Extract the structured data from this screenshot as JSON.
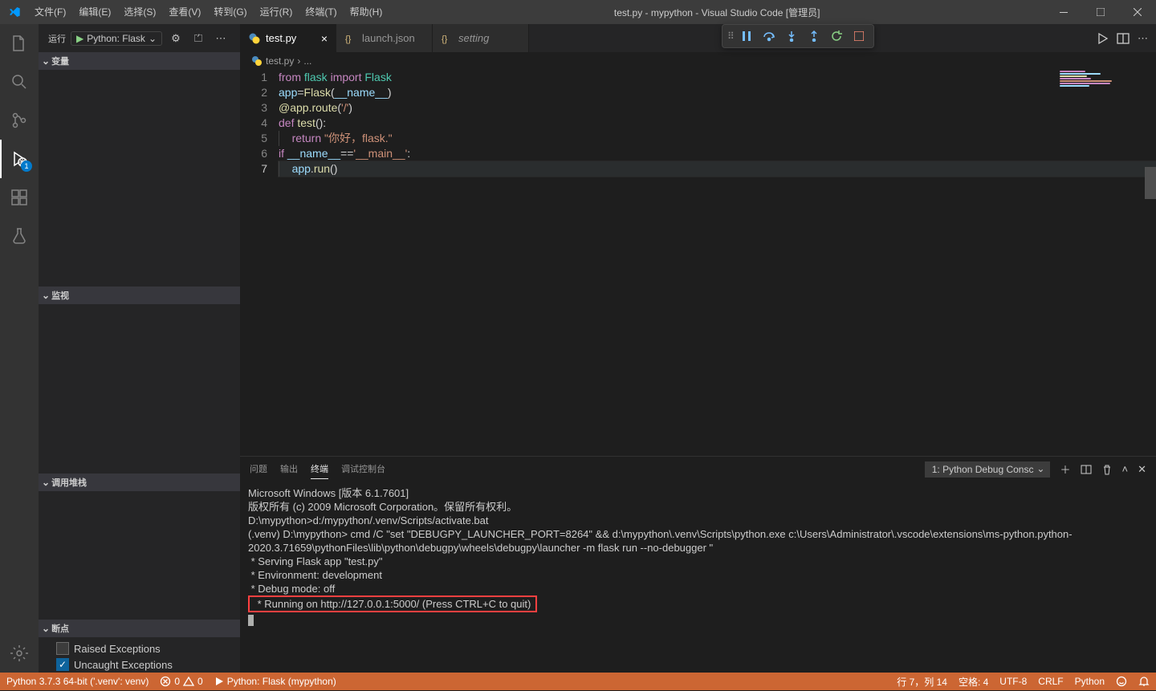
{
  "titlebar": {
    "menus": [
      "文件(F)",
      "编辑(E)",
      "选择(S)",
      "查看(V)",
      "转到(G)",
      "运行(R)",
      "终端(T)",
      "帮助(H)"
    ],
    "title": "test.py - mypython - Visual Studio Code [管理员]"
  },
  "activitybar": {
    "debug_badge": "1"
  },
  "sidebar": {
    "run_label": "运行",
    "config": "Python: Flask",
    "sections": {
      "variables": "变量",
      "watch": "监视",
      "callstack": "调用堆栈",
      "breakpoints": "断点"
    },
    "breakpoints": [
      {
        "label": "Raised Exceptions",
        "checked": false
      },
      {
        "label": "Uncaught Exceptions",
        "checked": true
      }
    ]
  },
  "tabs": [
    {
      "label": "test.py",
      "icon": "python",
      "active": true,
      "dirty": false
    },
    {
      "label": "launch.json",
      "icon": "json",
      "active": false,
      "dirty": false
    },
    {
      "label": "setting",
      "icon": "json",
      "active": false,
      "dirty": true,
      "italic": true
    }
  ],
  "breadcrumbs": [
    "test.py",
    "..."
  ],
  "code": {
    "lines": 7,
    "current_line": 7
  },
  "code_tokens": [
    [
      [
        "from",
        "kw"
      ],
      [
        " ",
        "p"
      ],
      [
        "flask",
        "mod"
      ],
      [
        " ",
        "p"
      ],
      [
        "import",
        "kw"
      ],
      [
        " ",
        "p"
      ],
      [
        "Flask",
        "mod"
      ]
    ],
    [
      [
        "app",
        "var"
      ],
      [
        "=",
        "op"
      ],
      [
        "Flask",
        "fn"
      ],
      [
        "(",
        "p"
      ],
      [
        "__name__",
        "var"
      ],
      [
        ")",
        "p"
      ]
    ],
    [
      [
        "@app.route",
        "at"
      ],
      [
        "(",
        "p"
      ],
      [
        "'/'",
        "str"
      ],
      [
        ")",
        "p"
      ]
    ],
    [
      [
        "def",
        "kw"
      ],
      [
        " ",
        "p"
      ],
      [
        "test",
        "fn"
      ],
      [
        "():",
        "p"
      ]
    ],
    [
      [
        "    ",
        "p"
      ],
      [
        "return",
        "kw"
      ],
      [
        " ",
        "p"
      ],
      [
        "\"你好，flask.\"",
        "str"
      ]
    ],
    [
      [
        "if",
        "kw"
      ],
      [
        " ",
        "p"
      ],
      [
        "__name__",
        "var"
      ],
      [
        "==",
        "op"
      ],
      [
        "'__main__'",
        "str"
      ],
      [
        ":",
        "p"
      ]
    ],
    [
      [
        "    ",
        "p"
      ],
      [
        "app",
        "var"
      ],
      [
        ".",
        "p"
      ],
      [
        "run",
        "fn"
      ],
      [
        "()",
        "p"
      ]
    ]
  ],
  "panel": {
    "tabs": [
      "问题",
      "输出",
      "终端",
      "调试控制台"
    ],
    "active": 2,
    "terminal_selector": "1: Python Debug Consc",
    "lines": [
      "Microsoft Windows [版本 6.1.7601]",
      "版权所有 (c) 2009 Microsoft Corporation。保留所有权利。",
      "",
      "D:\\mypython>d:/mypython/.venv/Scripts/activate.bat",
      "",
      "(.venv) D:\\mypython> cmd /C \"set \"DEBUGPY_LAUNCHER_PORT=8264\" && d:\\mypython\\.venv\\Scripts\\python.exe c:\\Users\\Administrator\\.vscode\\extensions\\ms-python.python-2020.3.71659\\pythonFiles\\lib\\python\\debugpy\\wheels\\debugpy\\launcher -m flask run --no-debugger \"",
      " * Serving Flask app \"test.py\"",
      " * Environment: development",
      " * Debug mode: off"
    ],
    "highlight": " * Running on http://127.0.0.1:5000/ (Press CTRL+C to quit)"
  },
  "statusbar": {
    "interpreter": "Python 3.7.3 64-bit ('.venv': venv)",
    "errors": "0",
    "warnings": "0",
    "debug": "Python: Flask (mypython)",
    "ln_col": "行 7，列 14",
    "spaces": "空格: 4",
    "encoding": "UTF-8",
    "eol": "CRLF",
    "lang": "Python"
  }
}
